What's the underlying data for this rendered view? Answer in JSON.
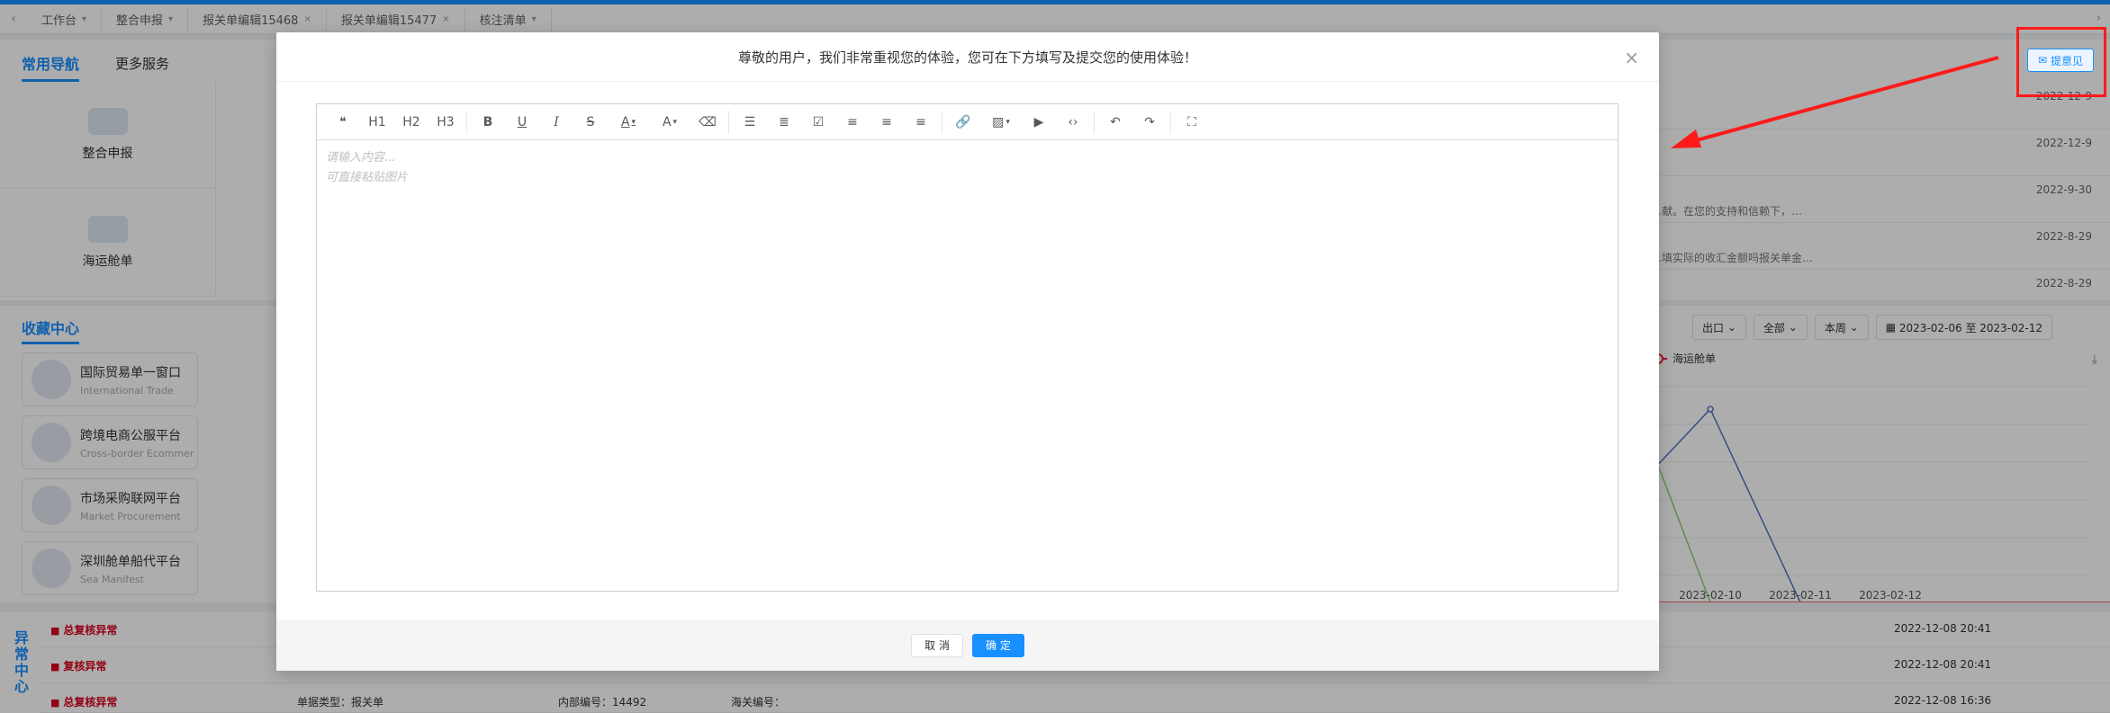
{
  "tabs": [
    {
      "label": "工作台",
      "active": false
    },
    {
      "label": "整合申报",
      "active": false
    },
    {
      "label": "报关单编辑15468",
      "active": false
    },
    {
      "label": "报关单编辑15477",
      "active": false
    },
    {
      "label": "核注清单",
      "active": false
    }
  ],
  "nav": {
    "tab_common": "常用导航",
    "tab_more": "更多服务",
    "items": [
      {
        "label": "整合申报"
      },
      {
        "label": "海运舱单"
      }
    ]
  },
  "news": [
    {
      "date": "2022-12-9",
      "text": ""
    },
    {
      "date": "2022-12-9",
      "text": ""
    },
    {
      "date": "2022-9-30",
      "text": "…献。在您的支持和信赖下，…"
    },
    {
      "date": "2022-8-29",
      "text": "…填实际的收汇金额吗报关单金…"
    },
    {
      "date": "2022-8-29",
      "text": ""
    }
  ],
  "favorites": {
    "title": "收藏中心",
    "items": [
      {
        "name": "国际贸易单一窗口",
        "en": "International Trade"
      },
      {
        "name": "跨境电商公服平台",
        "en": "Cross-border Ecommer"
      },
      {
        "name": "市场采购联网平台",
        "en": "Market Procurement"
      },
      {
        "name": "深圳舱单船代平台",
        "en": "Sea Manifest"
      }
    ]
  },
  "chart_filters": {
    "direction": "出口",
    "scope": "全部",
    "period": "本周",
    "date_range": "2023-02-06 至 2023-02-12"
  },
  "chart_data": {
    "type": "line",
    "x": [
      "2023-02-10",
      "2023-02-11",
      "2023-02-12"
    ],
    "series": [
      {
        "name": "海运舱单"
      }
    ],
    "xlabel": "",
    "ylabel": ""
  },
  "feedback_button": "提意见",
  "abnormal": {
    "side_title": "异常中心",
    "rows": [
      {
        "flag": "总复核异常",
        "time": "2022-12-08 20:41"
      },
      {
        "flag": "复核异常",
        "time": "2022-12-08 20:41"
      },
      {
        "flag": "总复核异常",
        "type_label": "单据类型：报关单",
        "inner_no": "内部编号：14492",
        "customs_no": "海关编号：",
        "time": "2022-12-08 16:36"
      }
    ]
  },
  "modal": {
    "title": "尊敬的用户，我们非常重视您的体验，您可在下方填写及提交您的使用体验！",
    "placeholder": "请输入内容...",
    "paste_hint": "可直接粘贴图片",
    "cancel": "取 消",
    "confirm": "确 定",
    "toolbar_text": {
      "h1": "H1",
      "h2": "H2",
      "h3": "H3",
      "bold": "B",
      "underline": "U",
      "italic": "I",
      "strike": "S",
      "font_color": "A",
      "bg_color": "A"
    }
  },
  "colors": {
    "primary": "#1890ff",
    "danger": "#d9001b",
    "annotation": "#ff1a1a"
  }
}
